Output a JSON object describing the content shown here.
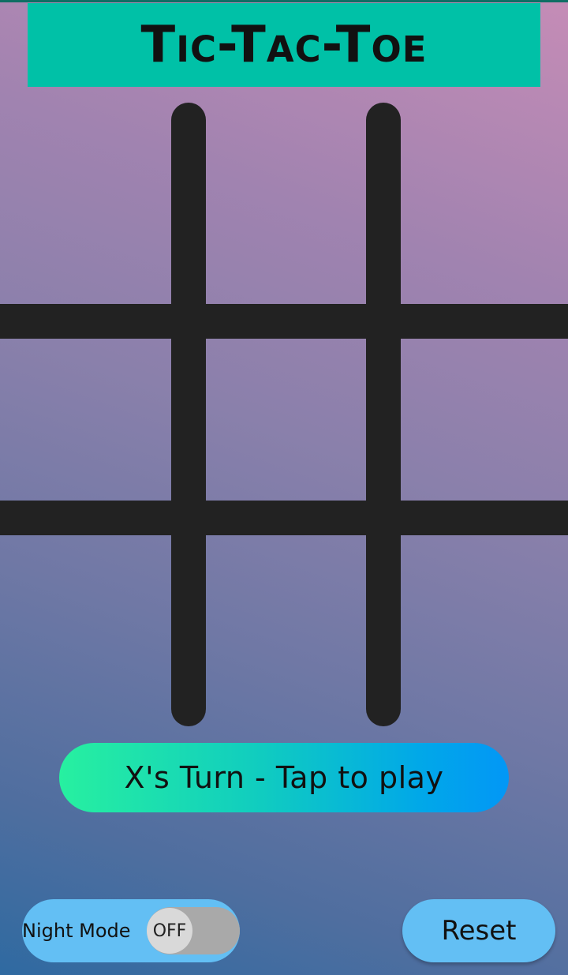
{
  "app": {
    "title": "Tic-Tac-Toe",
    "title_bar_color": "#00c1a7"
  },
  "board": {
    "line_color": "#222222",
    "cells": [
      "",
      "",
      "",
      "",
      "",
      "",
      "",
      "",
      ""
    ]
  },
  "status": {
    "turn_text": "X's Turn - Tap to play"
  },
  "controls": {
    "night_mode_label": "Night Mode",
    "night_mode_state": "OFF",
    "reset_label": "Reset",
    "button_color": "#63bff4"
  }
}
